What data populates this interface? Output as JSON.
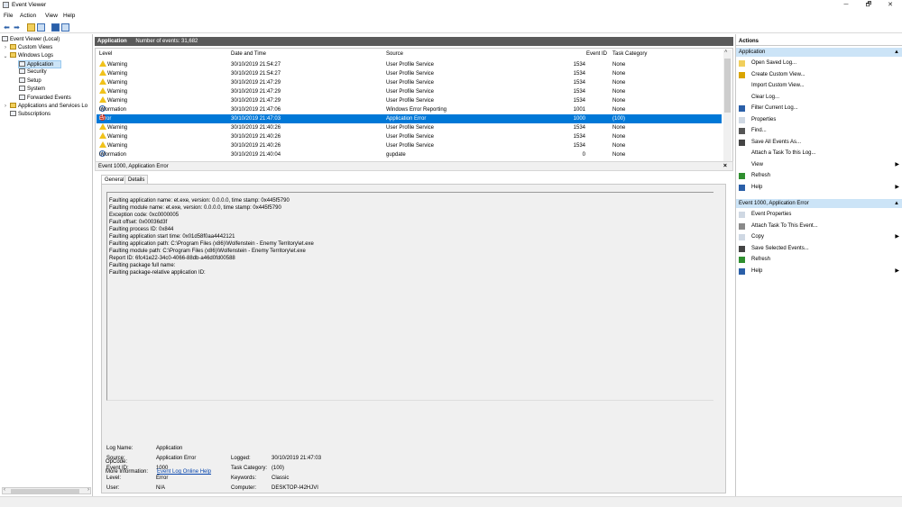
{
  "window": {
    "title": "Event Viewer",
    "minimize": "─",
    "maximize": "🗗",
    "close": "✕"
  },
  "menu": [
    "File",
    "Action",
    "View",
    "Help"
  ],
  "tree": {
    "root": "Event Viewer (Local)",
    "custom_views": "Custom Views",
    "windows_logs": "Windows Logs",
    "logs": [
      "Application",
      "Security",
      "Setup",
      "System",
      "Forwarded Events"
    ],
    "apps_services": "Applications and Services Lo",
    "subscriptions": "Subscriptions"
  },
  "pane": {
    "name": "Application",
    "count": "Number of events: 31,682"
  },
  "columns": {
    "level": "Level",
    "date": "Date and Time",
    "source": "Source",
    "event_id": "Event ID",
    "task": "Task Category"
  },
  "events": [
    {
      "level": "Warning",
      "date": "30/10/2019 21:54:27",
      "source": "User Profile Service",
      "id": "1534",
      "task": "None"
    },
    {
      "level": "Warning",
      "date": "30/10/2019 21:54:27",
      "source": "User Profile Service",
      "id": "1534",
      "task": "None"
    },
    {
      "level": "Warning",
      "date": "30/10/2019 21:47:29",
      "source": "User Profile Service",
      "id": "1534",
      "task": "None"
    },
    {
      "level": "Warning",
      "date": "30/10/2019 21:47:29",
      "source": "User Profile Service",
      "id": "1534",
      "task": "None"
    },
    {
      "level": "Warning",
      "date": "30/10/2019 21:47:29",
      "source": "User Profile Service",
      "id": "1534",
      "task": "None"
    },
    {
      "level": "Information",
      "date": "30/10/2019 21:47:06",
      "source": "Windows Error Reporting",
      "id": "1001",
      "task": "None"
    },
    {
      "level": "Error",
      "date": "30/10/2019 21:47:03",
      "source": "Application Error",
      "id": "1000",
      "task": "(100)"
    },
    {
      "level": "Warning",
      "date": "30/10/2019 21:40:26",
      "source": "User Profile Service",
      "id": "1534",
      "task": "None"
    },
    {
      "level": "Warning",
      "date": "30/10/2019 21:40:26",
      "source": "User Profile Service",
      "id": "1534",
      "task": "None"
    },
    {
      "level": "Warning",
      "date": "30/10/2019 21:40:26",
      "source": "User Profile Service",
      "id": "1534",
      "task": "None"
    },
    {
      "level": "Information",
      "date": "30/10/2019 21:40:04",
      "source": "gupdate",
      "id": "0",
      "task": "None"
    }
  ],
  "detail": {
    "header": "Event 1000, Application Error",
    "close": "×",
    "tab_general": "General",
    "tab_details": "Details",
    "message": [
      "Faulting application name: et.exe, version: 0.0.0.0, time stamp: 0x445f5790",
      "Faulting module name: et.exe, version: 0.0.0.0, time stamp: 0x445f5790",
      "Exception code: 0xc0000005",
      "Fault offset: 0x00036d3f",
      "Faulting process ID: 0x844",
      "Faulting application start time: 0x01d58f0aa4442121",
      "Faulting application path: C:\\Program Files (x86)\\Wolfenstein - Enemy Territory\\et.exe",
      "Faulting module path: C:\\Program Files (x86)\\Wolfenstein - Enemy Territory\\et.exe",
      "Report ID: 6fc41e22-34c0-4066-88db-a46d0fd00588",
      "Faulting package full name:",
      "Faulting package-relative application ID:"
    ],
    "props": {
      "log_name_label": "Log Name:",
      "log_name": "Application",
      "source_label": "Source:",
      "source": "Application Error",
      "logged_label": "Logged:",
      "logged": "30/10/2019 21:47:03",
      "event_id_label": "Event ID:",
      "event_id": "1000",
      "task_label": "Task Category:",
      "task": "(100)",
      "level_label": "Level:",
      "level": "Error",
      "keywords_label": "Keywords:",
      "keywords": "Classic",
      "user_label": "User:",
      "user": "N/A",
      "computer_label": "Computer:",
      "computer": "DESKTOP-I42HJVI",
      "opcode_label": "OpCode:",
      "more_info_label": "More Information:",
      "more_info_link": "Event Log Online Help"
    }
  },
  "actions": {
    "title": "Actions",
    "section1": "Application",
    "items1": [
      "Open Saved Log...",
      "Create Custom View...",
      "Import Custom View...",
      "Clear Log...",
      "Filter Current Log...",
      "Properties",
      "Find...",
      "Save All Events As...",
      "Attach a Task To this Log...",
      "View",
      "Refresh",
      "Help"
    ],
    "section2": "Event 1000, Application Error",
    "items2": [
      "Event Properties",
      "Attach Task To This Event...",
      "Copy",
      "Save Selected Events...",
      "Refresh",
      "Help"
    ]
  },
  "colors": {
    "selection": "#0078d7",
    "section_bg": "#cce4f7",
    "header_bg": "#5a5a5a",
    "warning": "#f1c21b",
    "error": "#c42b1c"
  }
}
